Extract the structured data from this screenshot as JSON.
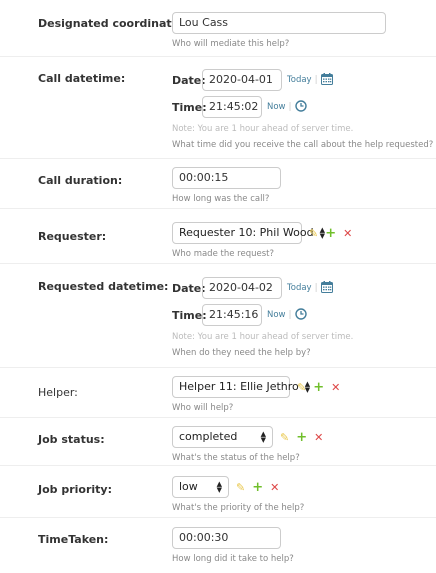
{
  "fields": {
    "coordinator": {
      "label": "Designated coordinator:",
      "value": "Lou Cass",
      "help": "Who will mediate this help?"
    },
    "call_datetime": {
      "label": "Call datetime:",
      "date_label": "Date:",
      "date_value": "2020-04-01",
      "today_link": "Today",
      "time_label": "Time:",
      "time_value": "21:45:02",
      "now_link": "Now",
      "note": "Note: You are 1 hour ahead of server time.",
      "help": "What time did you receive the call about the help requested?"
    },
    "call_duration": {
      "label": "Call duration:",
      "value": "00:00:15",
      "help": "How long was the call?"
    },
    "requester": {
      "label": "Requester:",
      "selected": "Requester 10: Phil Wood",
      "help": "Who made the request?"
    },
    "requested_datetime": {
      "label": "Requested datetime:",
      "date_label": "Date:",
      "date_value": "2020-04-02",
      "today_link": "Today",
      "time_label": "Time:",
      "time_value": "21:45:16",
      "now_link": "Now",
      "note": "Note: You are 1 hour ahead of server time.",
      "help": "When do they need the help by?"
    },
    "helper": {
      "label": "Helper:",
      "selected": "Helper 11: Ellie Jethro",
      "help": "Who will help?"
    },
    "job_status": {
      "label": "Job status:",
      "selected": "completed",
      "help": "What's the status of the help?"
    },
    "job_priority": {
      "label": "Job priority:",
      "selected": "low",
      "help": "What's the priority of the help?"
    },
    "time_taken": {
      "label": "TimeTaken:",
      "value": "00:00:30",
      "help": "How long did it take to help?"
    }
  },
  "colors": {
    "link": "#447e9b",
    "edit_icon": "#e9c74a",
    "add_icon": "#70bf2b",
    "delete_icon": "#dd4646"
  },
  "icons": {
    "date_shortcut": "calendar-icon",
    "time_shortcut": "clock-icon",
    "change_related": "pencil-icon",
    "add_related": "plus-icon",
    "delete_related": "x-icon"
  }
}
